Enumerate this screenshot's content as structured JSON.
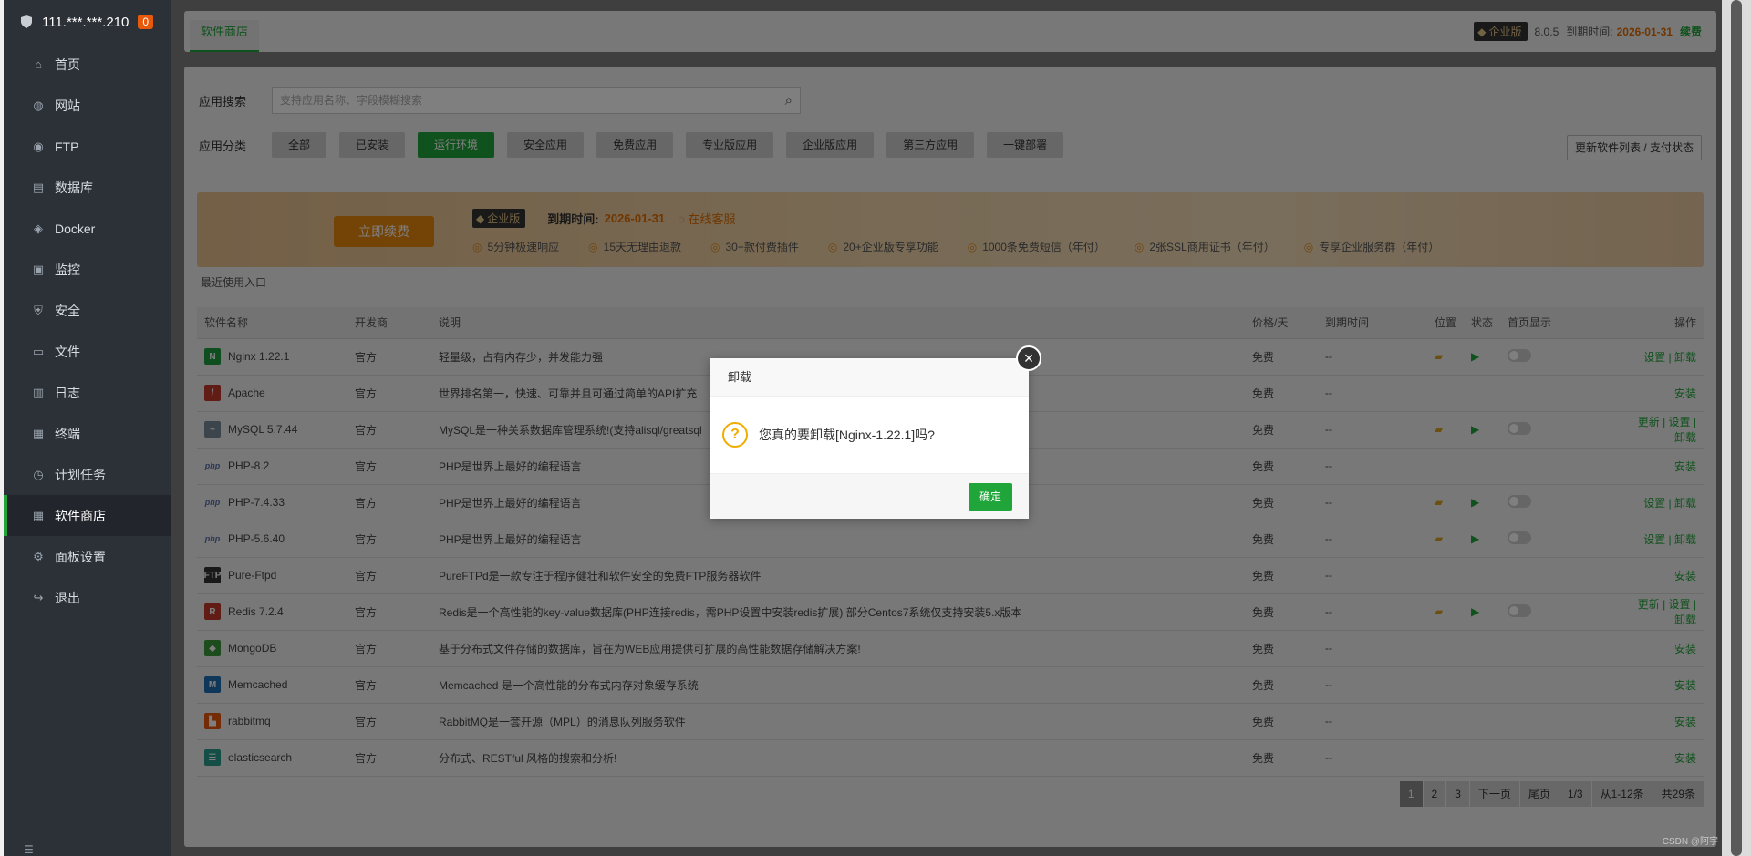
{
  "sidebar": {
    "host": "111.***.***.210",
    "badge": "0",
    "items": [
      {
        "label": "首页",
        "icon": "⌂"
      },
      {
        "label": "网站",
        "icon": "◍"
      },
      {
        "label": "FTP",
        "icon": "◉"
      },
      {
        "label": "数据库",
        "icon": "▤"
      },
      {
        "label": "Docker",
        "icon": "◈"
      },
      {
        "label": "监控",
        "icon": "▣"
      },
      {
        "label": "安全",
        "icon": "⛨"
      },
      {
        "label": "文件",
        "icon": "▭"
      },
      {
        "label": "日志",
        "icon": "▥"
      },
      {
        "label": "终端",
        "icon": "▦"
      },
      {
        "label": "计划任务",
        "icon": "◷"
      },
      {
        "label": "软件商店",
        "icon": "▦"
      },
      {
        "label": "面板设置",
        "icon": "⚙"
      },
      {
        "label": "退出",
        "icon": "↪"
      }
    ]
  },
  "topbar": {
    "tab": "软件商店",
    "edition": "企业版",
    "version": "8.0.5",
    "expire_label": "到期时间:",
    "expire_date": "2026-01-31",
    "renew": "续费"
  },
  "search": {
    "label": "应用搜索",
    "placeholder": "支持应用名称、字段模糊搜索"
  },
  "category": {
    "label": "应用分类",
    "items": [
      "全部",
      "已安装",
      "运行环境",
      "安全应用",
      "免费应用",
      "专业版应用",
      "企业版应用",
      "第三方应用",
      "一键部署"
    ],
    "active": "运行环境",
    "update_btn": "更新软件列表 / 支付状态"
  },
  "banner": {
    "renew_btn": "立即续费",
    "edition": "企业版",
    "expire_label": "到期时间:",
    "expire_date": "2026-01-31",
    "service": "在线客服",
    "features": [
      "5分钟极速响应",
      "15天无理由退款",
      "30+款付费插件",
      "20+企业版专享功能",
      "1000条免费短信（年付）",
      "2张SSL商用证书（年付）",
      "专享企业服务群（年付）"
    ]
  },
  "recent_label": "最近使用入口",
  "table": {
    "headers": [
      "软件名称",
      "开发商",
      "说明",
      "价格/天",
      "到期时间",
      "位置",
      "状态",
      "首页显示",
      "操作"
    ],
    "rows": [
      {
        "name": "Nginx 1.22.1",
        "logo": "N",
        "logo_color": "#1e9e3e",
        "dev": "官方",
        "desc": "轻量级，占有内存少，并发能力强",
        "price": "免费",
        "expire": "--",
        "installed": true,
        "ops": "设置 | 卸载"
      },
      {
        "name": "Apache",
        "logo": "/",
        "logo_color": "#c0392b",
        "dev": "官方",
        "desc": "世界排名第一，快速、可靠并且可通过简单的API扩充",
        "price": "免费",
        "expire": "--",
        "installed": false,
        "ops": "安装"
      },
      {
        "name": "MySQL 5.7.44",
        "logo": "~",
        "logo_color": "#7a8a99",
        "dev": "官方",
        "desc": "MySQL是一种关系数据库管理系统!(支持alisql/greatsql",
        "price": "免费",
        "expire": "--",
        "installed": true,
        "ops": "更新 | 设置 | 卸载"
      },
      {
        "name": "PHP-8.2",
        "logo": "php",
        "logo_color": "#5b6fa8",
        "dev": "官方",
        "desc": "PHP是世界上最好的编程语言",
        "price": "免费",
        "expire": "--",
        "installed": false,
        "ops": "安装"
      },
      {
        "name": "PHP-7.4.33",
        "logo": "php",
        "logo_color": "#5b6fa8",
        "dev": "官方",
        "desc": "PHP是世界上最好的编程语言",
        "price": "免费",
        "expire": "--",
        "installed": true,
        "ops": "设置 | 卸载"
      },
      {
        "name": "PHP-5.6.40",
        "logo": "php",
        "logo_color": "#5b6fa8",
        "dev": "官方",
        "desc": "PHP是世界上最好的编程语言",
        "price": "免费",
        "expire": "--",
        "installed": true,
        "ops": "设置 | 卸载"
      },
      {
        "name": "Pure-Ftpd",
        "logo": "FTP",
        "logo_color": "#333333",
        "dev": "官方",
        "desc": "PureFTPd是一款专注于程序健壮和软件安全的免费FTP服务器软件",
        "price": "免费",
        "expire": "--",
        "installed": false,
        "ops": "安装"
      },
      {
        "name": "Redis 7.2.4",
        "logo": "R",
        "logo_color": "#c0392b",
        "dev": "官方",
        "desc": "Redis是一个高性能的key-value数据库(PHP连接redis，需PHP设置中安装redis扩展) 部分Centos7系统仅支持安装5.x版本",
        "price": "免费",
        "expire": "--",
        "installed": true,
        "ops": "更新 | 设置 | 卸载"
      },
      {
        "name": "MongoDB",
        "logo": "◆",
        "logo_color": "#3a9a3a",
        "dev": "官方",
        "desc": "基于分布式文件存储的数据库，旨在为WEB应用提供可扩展的高性能数据存储解决方案!",
        "price": "免费",
        "expire": "--",
        "installed": false,
        "ops": "安装"
      },
      {
        "name": "Memcached",
        "logo": "M",
        "logo_color": "#1f6fb5",
        "dev": "官方",
        "desc": "Memcached 是一个高性能的分布式内存对象缓存系统",
        "price": "免费",
        "expire": "--",
        "installed": false,
        "ops": "安装"
      },
      {
        "name": "rabbitmq",
        "logo": "▙",
        "logo_color": "#e8590c",
        "dev": "官方",
        "desc": "RabbitMQ是一套开源（MPL）的消息队列服务软件",
        "price": "免费",
        "expire": "--",
        "installed": false,
        "ops": "安装"
      },
      {
        "name": "elasticsearch",
        "logo": "☰",
        "logo_color": "#2a9d8f",
        "dev": "官方",
        "desc": "分布式、RESTful 风格的搜索和分析!",
        "price": "免费",
        "expire": "--",
        "installed": false,
        "ops": "安装"
      }
    ]
  },
  "pager": [
    "1",
    "2",
    "3",
    "下一页",
    "尾页",
    "1/3",
    "从1-12条",
    "共29条"
  ],
  "modal": {
    "title": "卸载",
    "message": "您真的要卸载[Nginx-1.22.1]吗?",
    "ok": "确定"
  },
  "watermark": "CSDN @阿字"
}
